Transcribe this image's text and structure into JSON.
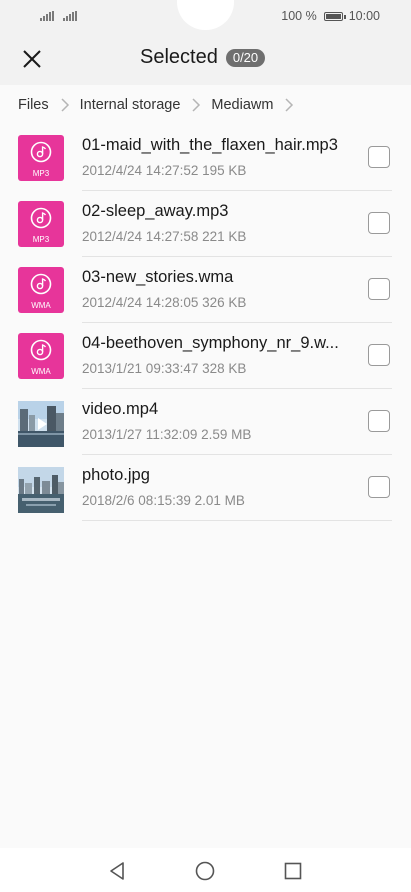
{
  "status_bar": {
    "battery_text": "100 %",
    "time": "10:00"
  },
  "header": {
    "title": "Selected",
    "selected_count": "0/20",
    "close_icon": "close-icon"
  },
  "breadcrumb": {
    "items": [
      "Files",
      "Internal storage",
      "Mediawm"
    ]
  },
  "files": [
    {
      "name": "01-maid_with_the_flaxen_hair.mp3",
      "date": "2012/4/24 14:27:52",
      "size": "195 KB",
      "type_label": "MP3",
      "thumbnail": "music-icon"
    },
    {
      "name": "02-sleep_away.mp3",
      "date": "2012/4/24 14:27:58",
      "size": "221 KB",
      "type_label": "MP3",
      "thumbnail": "music-icon"
    },
    {
      "name": "03-new_stories.wma",
      "date": "2012/4/24 14:28:05",
      "size": "326 KB",
      "type_label": "WMA",
      "thumbnail": "music-icon"
    },
    {
      "name": "04-beethoven_symphony_nr_9.w...",
      "date": "2013/1/21 09:33:47",
      "size": "328 KB",
      "type_label": "WMA",
      "thumbnail": "music-icon"
    },
    {
      "name": "video.mp4",
      "date": "2013/1/27 11:32:09",
      "size": "2.59 MB",
      "thumbnail": "video-thumbnail"
    },
    {
      "name": "photo.jpg",
      "date": "2018/2/6 08:15:39",
      "size": "2.01 MB",
      "thumbnail": "photo-thumbnail"
    }
  ],
  "nav_bar": {
    "icons": [
      "back-icon",
      "home-icon",
      "recents-icon"
    ]
  },
  "colors": {
    "audio_thumb": "#e7359a",
    "badge": "#6f6f6f",
    "background": "#fafafa"
  }
}
